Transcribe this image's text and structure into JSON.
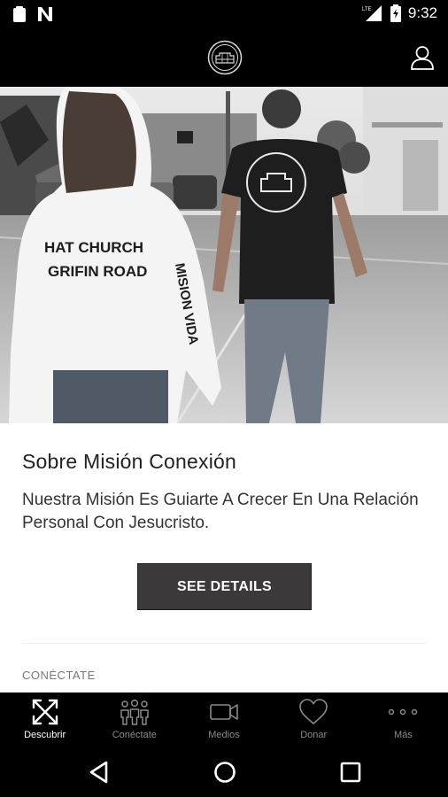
{
  "status_bar": {
    "time": "9:32",
    "network": "LTE"
  },
  "hero": {
    "shirt_text_1": "HAT CHURCH",
    "shirt_text_2": "GRIFIN ROAD",
    "sleeve_text": "MISION VIDA"
  },
  "content": {
    "title": "Sobre Misión Conexión",
    "description": "Nuestra Misión Es Guiarte A Crecer En Una Relación Personal Con Jesucristo.",
    "button_label": "SEE DETAILS",
    "section_label": "CONÉCTATE"
  },
  "bottom_nav": {
    "items": [
      {
        "label": "Descubrir",
        "icon": "expand-arrows-icon",
        "active": true
      },
      {
        "label": "Conéctate",
        "icon": "people-icon",
        "active": false
      },
      {
        "label": "Medios",
        "icon": "video-camera-icon",
        "active": false
      },
      {
        "label": "Donar",
        "icon": "heart-icon",
        "active": false
      },
      {
        "label": "Más",
        "icon": "more-dots-icon",
        "active": false
      }
    ]
  },
  "colors": {
    "bar": "#000000",
    "button": "#3b393a",
    "active": "#ffffff",
    "inactive": "#8a8a8a"
  }
}
